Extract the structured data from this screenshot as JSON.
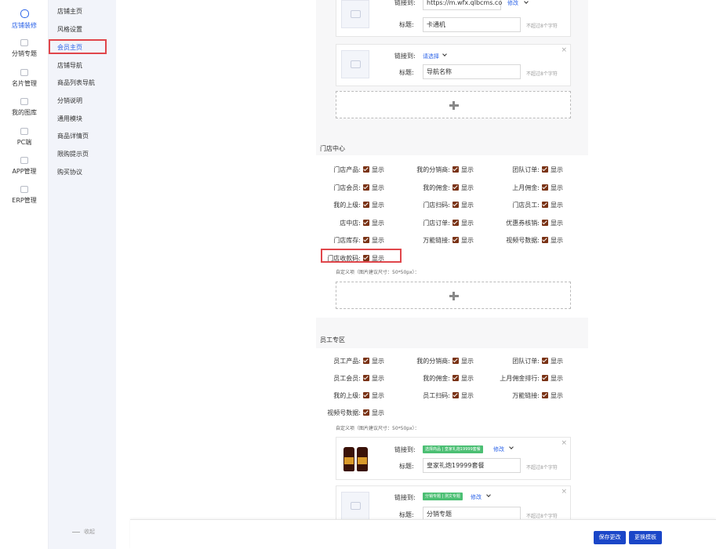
{
  "left_nav": [
    {
      "label": "店铺装修",
      "icon": "palette-icon",
      "active": true
    },
    {
      "label": "分销专题",
      "icon": "network-icon"
    },
    {
      "label": "名片管理",
      "icon": "card-icon"
    },
    {
      "label": "我的图库",
      "icon": "image-icon"
    },
    {
      "label": "PC端",
      "icon": "monitor-icon"
    },
    {
      "label": "APP管理",
      "icon": "mobile-icon"
    },
    {
      "label": "ERP管理",
      "icon": "erp-icon"
    }
  ],
  "sub_nav": [
    {
      "label": "店铺主页"
    },
    {
      "label": "风格设置"
    },
    {
      "label": "会员主页",
      "active": true
    },
    {
      "label": "店铺导航"
    },
    {
      "label": "商品列表导航"
    },
    {
      "label": "分销说明"
    },
    {
      "label": "通用模块"
    },
    {
      "label": "商品详情页"
    },
    {
      "label": "限购提示页"
    },
    {
      "label": "购买协议"
    }
  ],
  "collapse_label": "收起",
  "top_links": [
    {
      "link_label": "链接到:",
      "link_value": "https://m.wfx.qlbcms.co",
      "modify": "修改",
      "title_label": "标题:",
      "title_value": "卡通机",
      "hint": "不超过8个字符"
    },
    {
      "link_label": "链接到:",
      "link_value": "请选择",
      "title_label": "标题:",
      "title_value": "导航名称",
      "hint": "不超过8个字符"
    }
  ],
  "store_center": {
    "title": "门店中心",
    "show_label": "显示",
    "items": [
      [
        "门店产品:",
        "我的分销商:",
        "团队订单:"
      ],
      [
        "门店会员:",
        "我的佣金:",
        "上月佣金:"
      ],
      [
        "我的上级:",
        "门店扫码:",
        "门店员工:"
      ],
      [
        "店中店:",
        "门店订单:",
        "优惠券核销:"
      ],
      [
        "门店库存:",
        "万能链接:",
        "视频号数据:"
      ],
      [
        "门店收款码:"
      ]
    ],
    "custom_label": "自定义项（图片建议尺寸：50*50px）："
  },
  "staff_zone": {
    "title": "员工专区",
    "show_label": "显示",
    "items": [
      [
        "员工产品:",
        "我的分销商:",
        "团队订单:"
      ],
      [
        "员工会员:",
        "我的佣金:",
        "上月佣金排行:"
      ],
      [
        "我的上级:",
        "员工扫码:",
        "万能链接:"
      ],
      [
        "视频号数据:"
      ]
    ],
    "custom_label": "自定义项（图片建议尺寸：50*50px）：",
    "links": [
      {
        "link_label": "链接到:",
        "tag": "选择商品 | 皇家礼炮19999套餐",
        "modify": "修改",
        "title_label": "标题:",
        "title_value": "皇家礼炮19999套餐",
        "hint": "不超过8个字符"
      },
      {
        "link_label": "链接到:",
        "tag": "分销专题 | 测文专题",
        "modify": "修改",
        "title_label": "标题:",
        "title_value": "分销专题",
        "hint": "不超过8个字符"
      }
    ]
  },
  "buttons": {
    "save": "保存更改",
    "switch_template": "更换模板"
  },
  "close_glyph": "×",
  "colors": {
    "accent": "#2b63e8",
    "highlight": "#e0464b",
    "checkbox": "#7a3316",
    "primary_button": "#1a46c8",
    "tag_green": "#4bbf73"
  }
}
